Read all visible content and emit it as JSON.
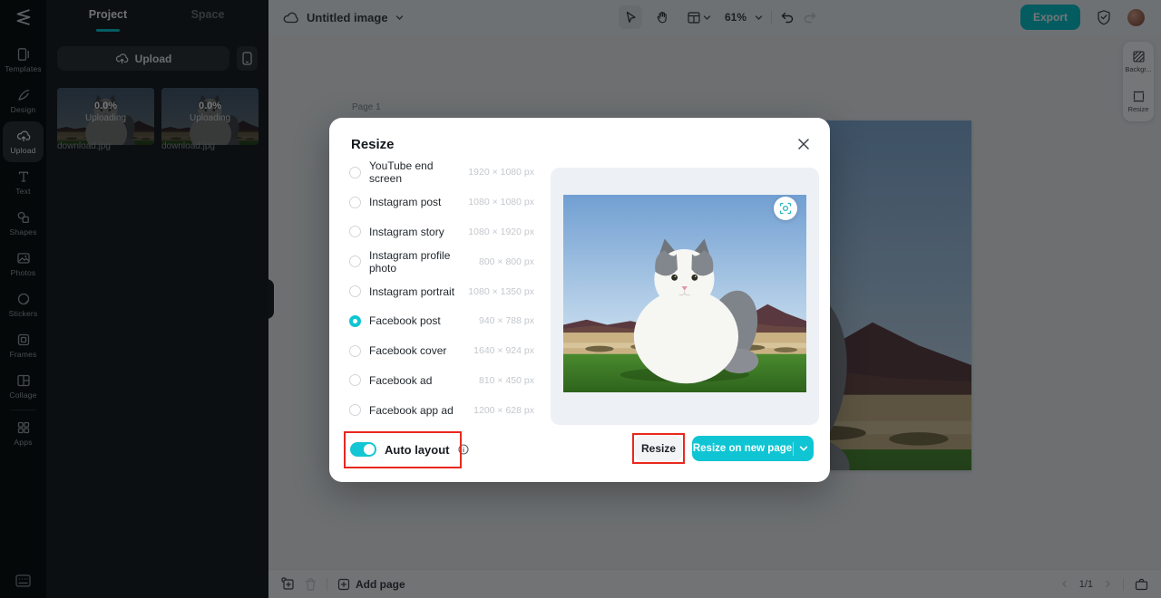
{
  "colors": {
    "accent": "#00c4cc",
    "annotation_red": "#e8281e",
    "toggle_on": "#14c6d4"
  },
  "left_rail": {
    "items": [
      {
        "label": "Templates"
      },
      {
        "label": "Design"
      },
      {
        "label": "Upload",
        "active": true
      },
      {
        "label": "Text"
      },
      {
        "label": "Shapes"
      },
      {
        "label": "Photos"
      },
      {
        "label": "Stickers"
      },
      {
        "label": "Frames"
      },
      {
        "label": "Collage"
      },
      {
        "label": "Apps"
      }
    ]
  },
  "left_panel": {
    "tabs": [
      {
        "label": "Project",
        "active": true
      },
      {
        "label": "Space"
      }
    ],
    "upload_button_label": "Upload",
    "uploads": [
      {
        "filename": "download.jpg",
        "progress": "0.0%",
        "status": "Uploading"
      },
      {
        "filename": "download.jpg",
        "progress": "0.0%",
        "status": "Uploading"
      }
    ]
  },
  "topbar": {
    "document_title": "Untitled image",
    "zoom_level": "61%",
    "export_label": "Export"
  },
  "canvas": {
    "page_label": "Page 1"
  },
  "right_toolbar": {
    "items": [
      {
        "label": "Backgr..."
      },
      {
        "label": "Resize"
      }
    ]
  },
  "bottombar": {
    "add_page_label": "Add page",
    "page_indicator": "1/1"
  },
  "modal": {
    "title": "Resize",
    "presets": [
      {
        "label": "YouTube end screen",
        "size": "1920 × 1080 px",
        "selected": false
      },
      {
        "label": "Instagram post",
        "size": "1080 × 1080 px",
        "selected": false
      },
      {
        "label": "Instagram story",
        "size": "1080 × 1920 px",
        "selected": false
      },
      {
        "label": "Instagram profile photo",
        "size": "800 × 800 px",
        "selected": false
      },
      {
        "label": "Instagram portrait",
        "size": "1080 × 1350 px",
        "selected": false
      },
      {
        "label": "Facebook post",
        "size": "940 × 788 px",
        "selected": true
      },
      {
        "label": "Facebook cover",
        "size": "1640 × 924 px",
        "selected": false
      },
      {
        "label": "Facebook ad",
        "size": "810 × 450 px",
        "selected": false
      },
      {
        "label": "Facebook app ad",
        "size": "1200 × 628 px",
        "selected": false
      }
    ],
    "auto_layout_label": "Auto layout",
    "auto_layout_on": true,
    "resize_button_label": "Resize",
    "resize_new_page_label": "Resize on new page"
  }
}
